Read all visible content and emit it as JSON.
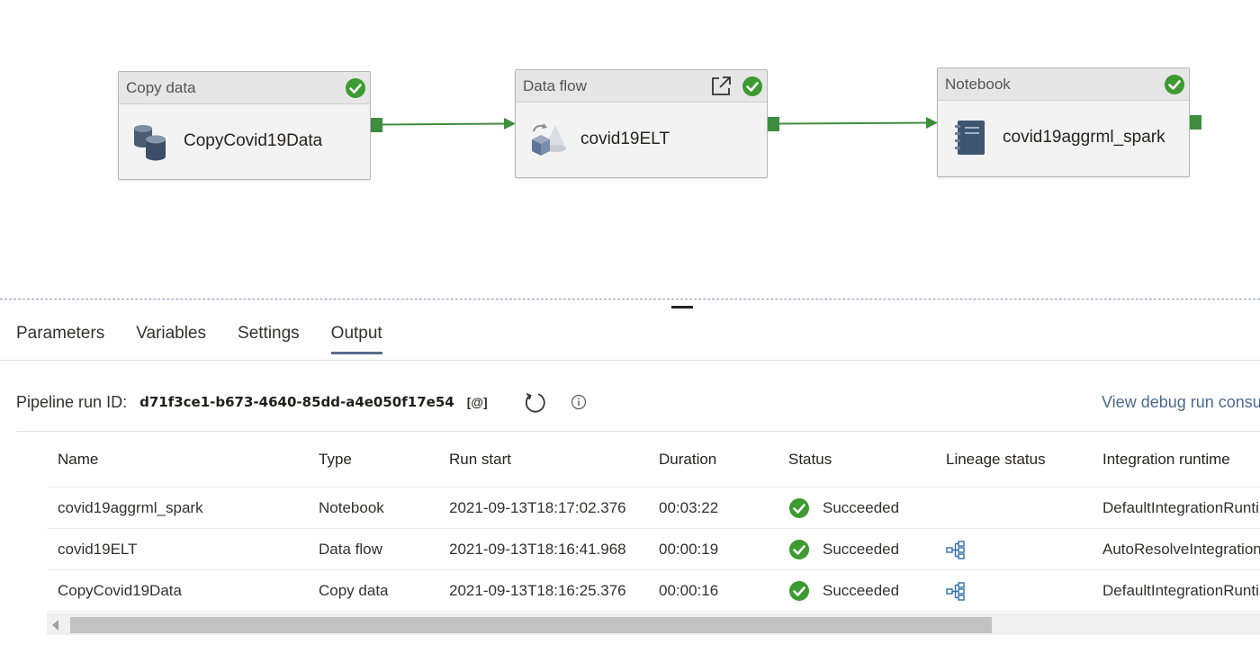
{
  "activities": [
    {
      "type": "Copy data",
      "name": "CopyCovid19Data"
    },
    {
      "type": "Data flow",
      "name": "covid19ELT"
    },
    {
      "type": "Notebook",
      "name": "covid19aggrml_spark"
    }
  ],
  "tabs": [
    "Parameters",
    "Variables",
    "Settings",
    "Output"
  ],
  "active_tab": "Output",
  "run": {
    "label": "Pipeline run ID:",
    "id": "d71f3ce1-b673-4640-85dd-a4e050f17e54",
    "copy_glyph": "[@]",
    "view_link": "View debug run consumption"
  },
  "table": {
    "headers": [
      "Name",
      "Type",
      "Run start",
      "Duration",
      "Status",
      "Lineage status",
      "Integration runtime"
    ],
    "rows": [
      {
        "name": "covid19aggrml_spark",
        "type": "Notebook",
        "run_start": "2021-09-13T18:17:02.376",
        "duration": "00:03:22",
        "status": "Succeeded",
        "lineage": false,
        "runtime": "DefaultIntegrationRuntime"
      },
      {
        "name": "covid19ELT",
        "type": "Data flow",
        "run_start": "2021-09-13T18:16:41.968",
        "duration": "00:00:19",
        "status": "Succeeded",
        "lineage": true,
        "runtime": "AutoResolveIntegrationRuntime"
      },
      {
        "name": "CopyCovid19Data",
        "type": "Copy data",
        "run_start": "2021-09-13T18:16:25.376",
        "duration": "00:00:16",
        "status": "Succeeded",
        "lineage": true,
        "runtime": "DefaultIntegrationRuntime"
      }
    ]
  },
  "icons": {
    "success": "check-circle-icon",
    "lineage": "lineage-icon",
    "refresh": "refresh-icon",
    "info": "info-icon",
    "open": "open-external-icon"
  },
  "colors": {
    "success": "#3c9a30",
    "port": "#3e8d3e",
    "link": "#4a6a8e"
  }
}
